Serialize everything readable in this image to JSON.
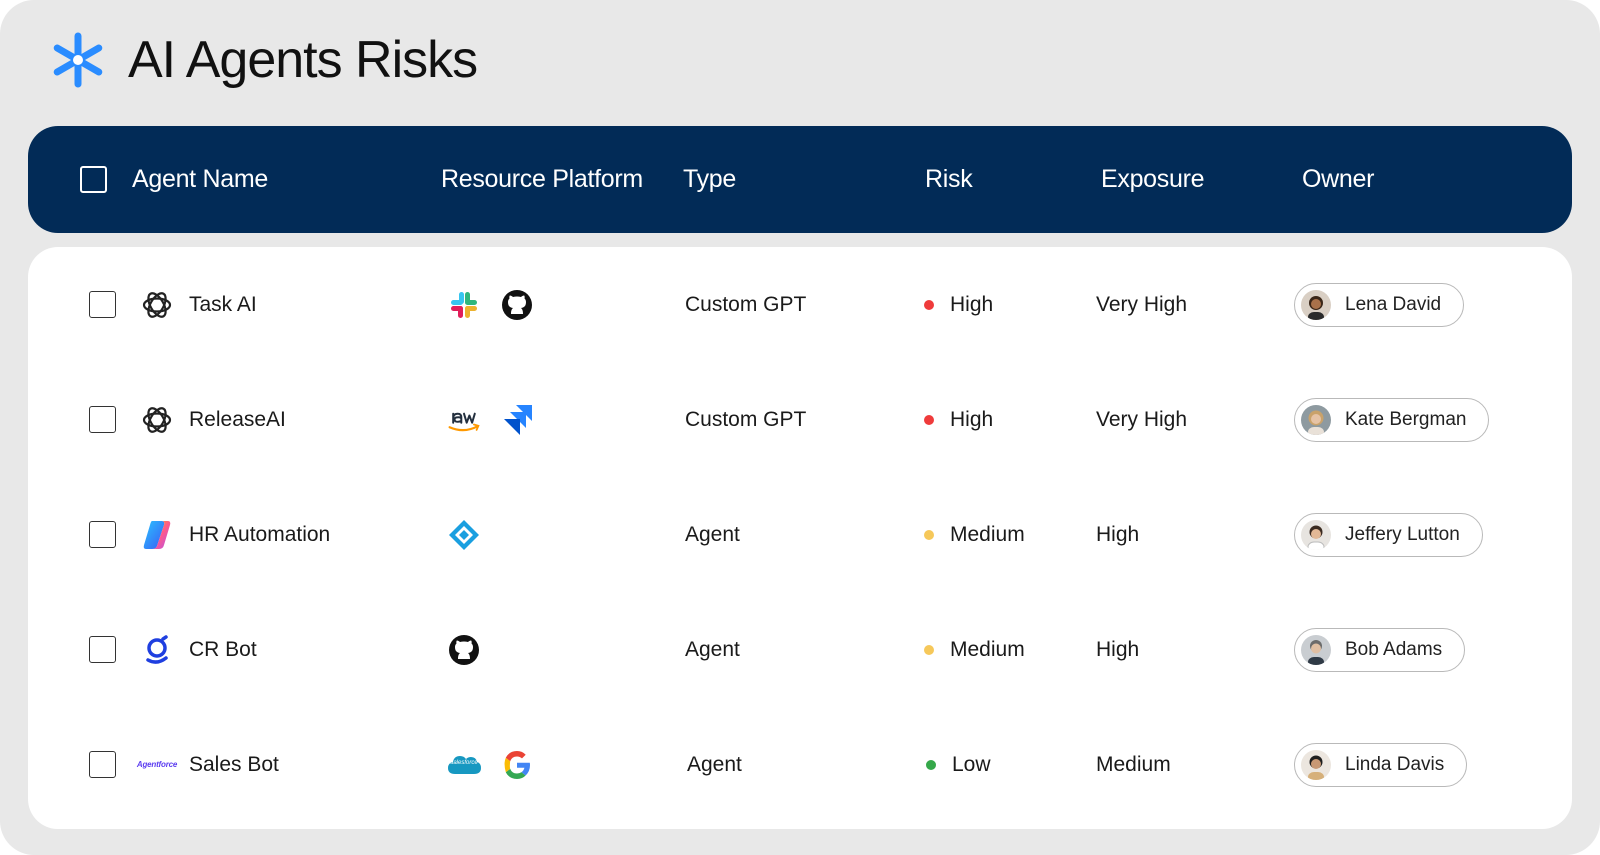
{
  "page": {
    "title": "AI Agents Risks",
    "logo_icon": "asterisk-icon",
    "accent": "#2a8cff"
  },
  "table": {
    "columns": {
      "agent_name": "Agent Name",
      "resource_platform": "Resource Platform",
      "type": "Type",
      "risk": "Risk",
      "exposure": "Exposure",
      "owner": "Owner"
    },
    "risk_colors": {
      "High": "#ef3b3b",
      "Medium": "#f6c85a",
      "Low": "#35a84a"
    },
    "rows": [
      {
        "agent_name": "Task AI",
        "agent_icon": "openai-icon",
        "platforms": [
          "slack-icon",
          "github-icon"
        ],
        "type": "Custom GPT",
        "risk": "High",
        "exposure": "Very High",
        "owner": "Lena David"
      },
      {
        "agent_name": "ReleaseAI",
        "agent_icon": "openai-icon",
        "platforms": [
          "aws-icon",
          "jira-icon"
        ],
        "type": "Custom GPT",
        "risk": "High",
        "exposure": "Very High",
        "owner": "Kate Bergman"
      },
      {
        "agent_name": "HR Automation",
        "agent_icon": "copilot-icon",
        "platforms": [
          "azure-devops-icon"
        ],
        "type": "Agent",
        "risk": "Medium",
        "exposure": "High",
        "owner": "Jeffery Lutton"
      },
      {
        "agent_name": "CR Bot",
        "agent_icon": "cr-bot-icon",
        "platforms": [
          "github-icon"
        ],
        "type": "Agent",
        "risk": "Medium",
        "exposure": "High",
        "owner": "Bob Adams"
      },
      {
        "agent_name": "Sales Bot",
        "agent_icon": "agentforce-icon",
        "agent_icon_text": "Agentforce",
        "platforms": [
          "salesforce-icon",
          "google-icon"
        ],
        "platform_text": "salesforce",
        "type": "Agent",
        "risk": "Low",
        "exposure": "Medium",
        "owner": "Linda Davis"
      }
    ]
  }
}
